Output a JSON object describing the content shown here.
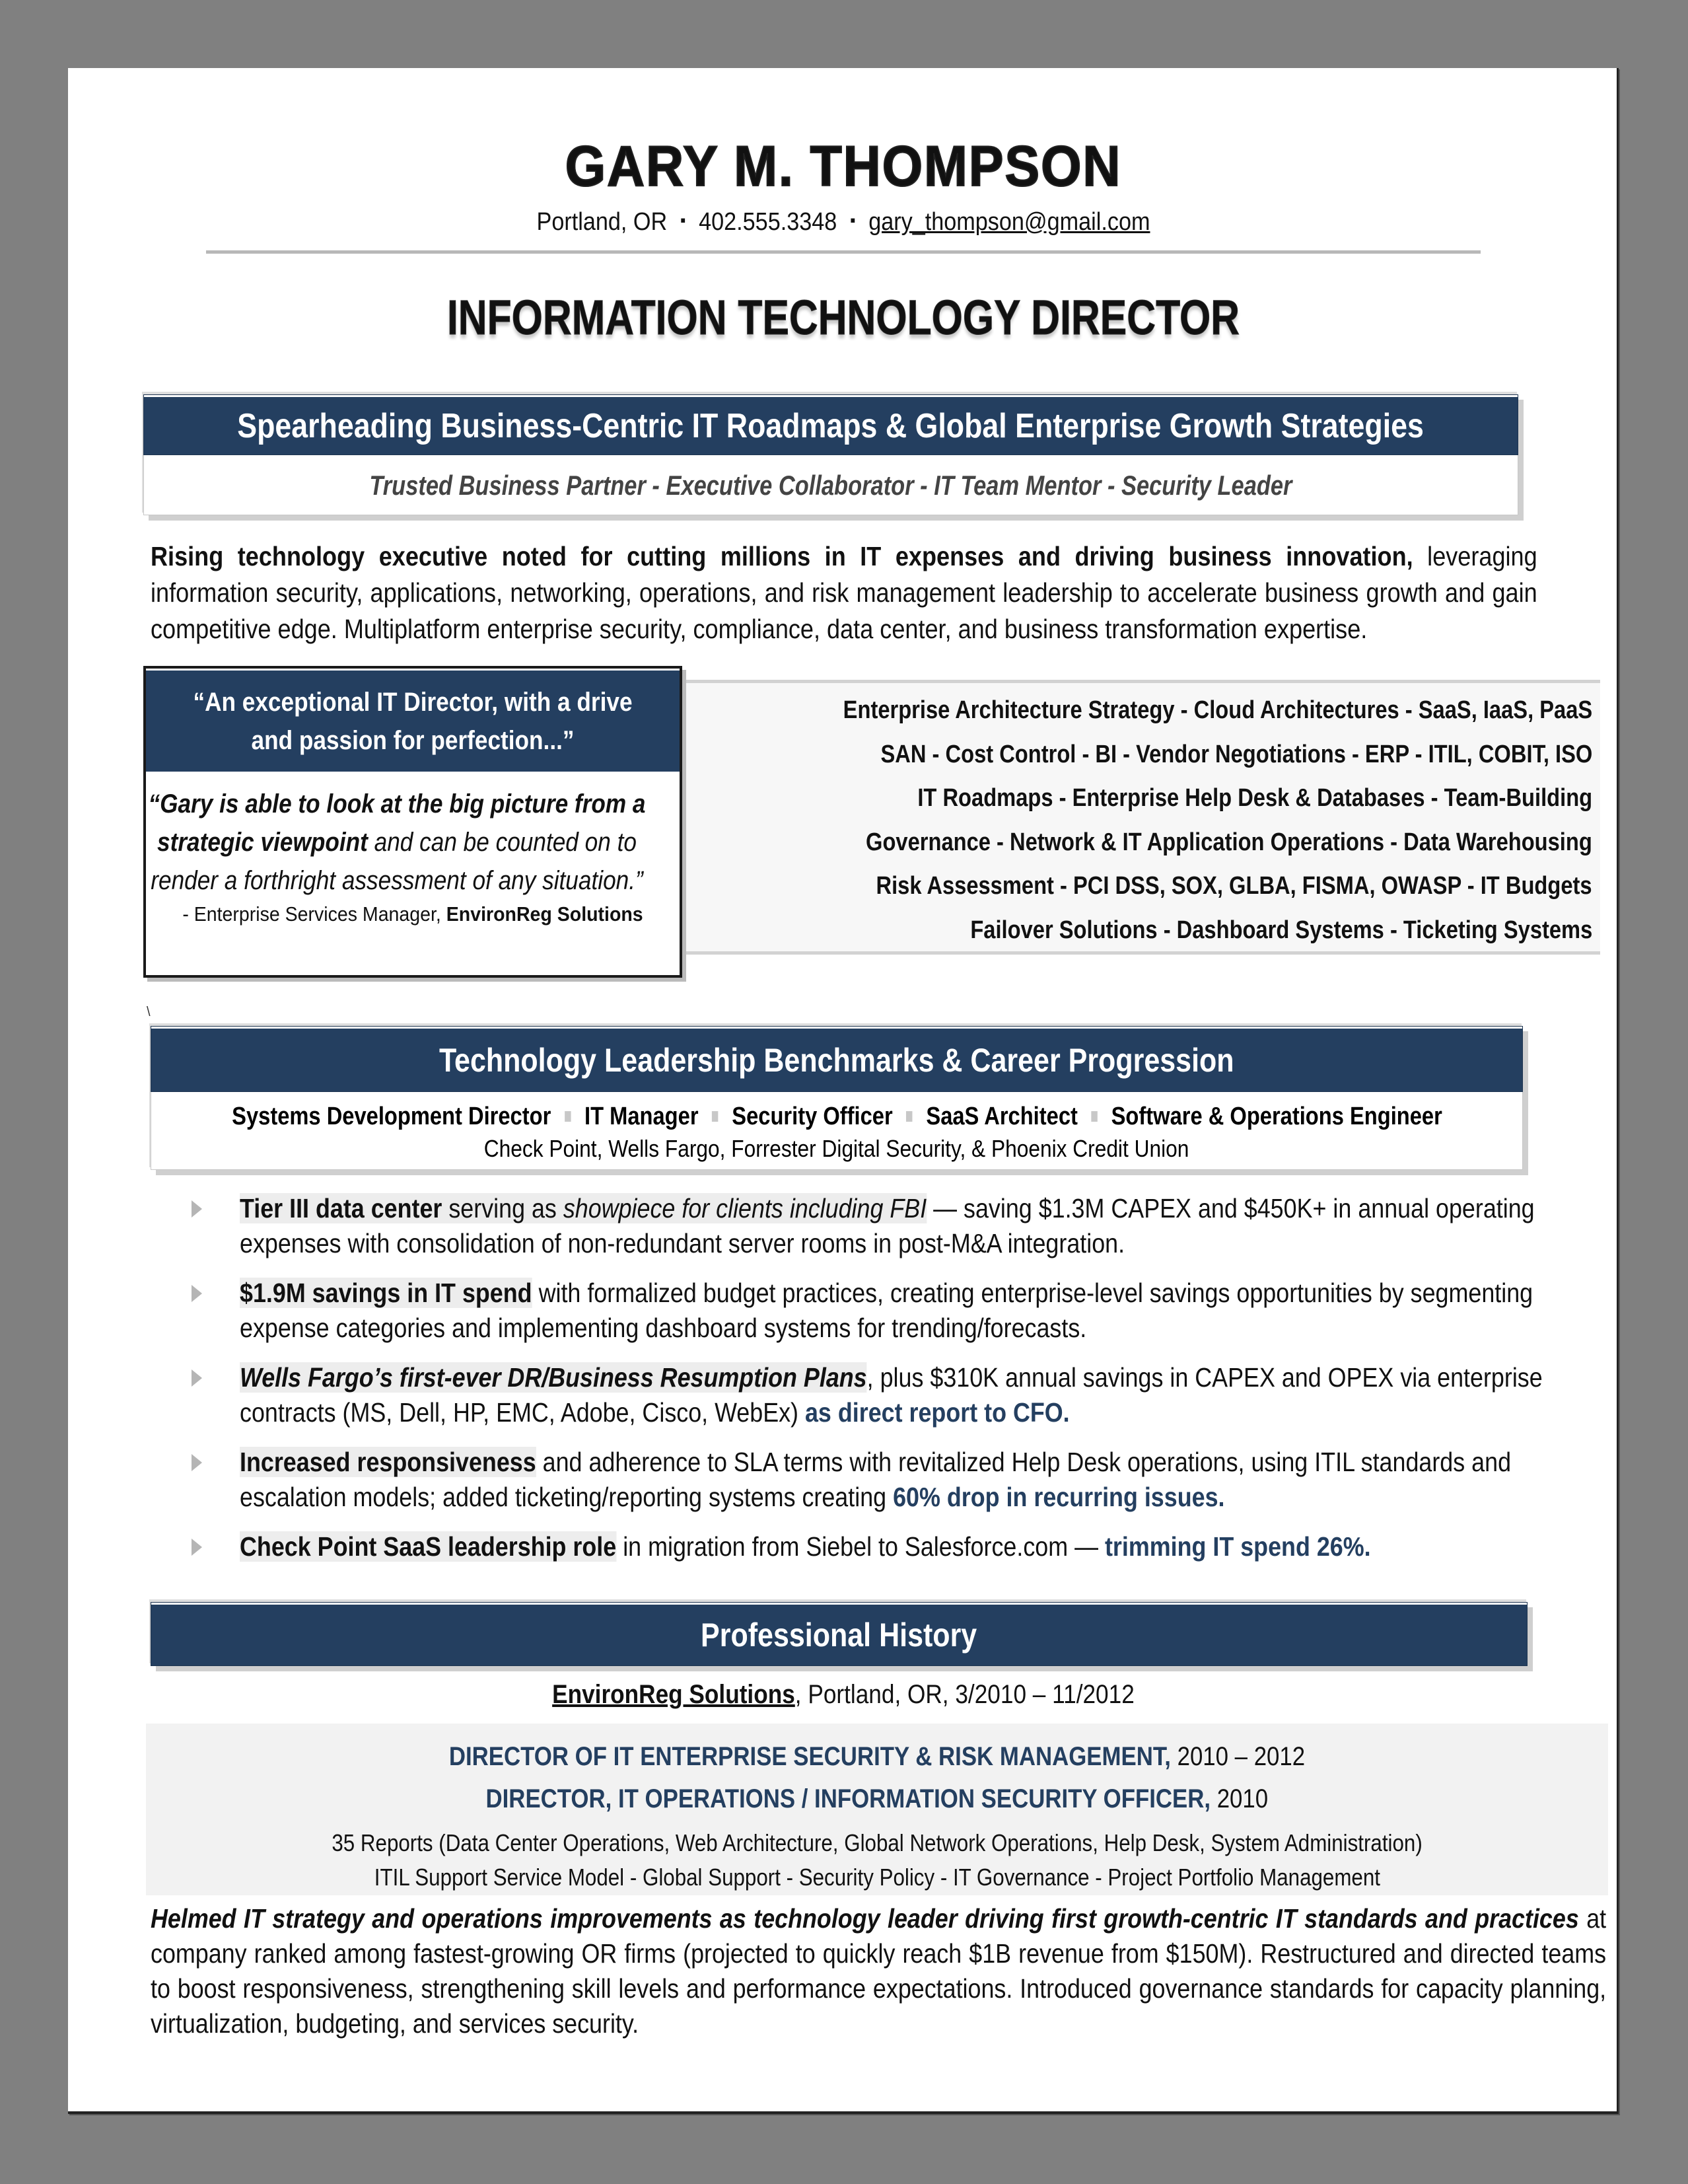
{
  "header": {
    "name": "GARY M. THOMPSON",
    "location": "Portland, OR",
    "phone": "402.555.3348",
    "email": "gary_thompson@gmail.com",
    "separator": "▪",
    "title": "INFORMATION TECHNOLOGY DIRECTOR"
  },
  "branding": {
    "headline": "Spearheading Business-Centric IT Roadmaps & Global Enterprise Growth Strategies",
    "tagline": "Trusted Business Partner  -  Executive Collaborator  -  IT Team Mentor  -  Security Leader"
  },
  "summary": {
    "lead_bold": "Rising technology executive noted for cutting millions in IT expenses and driving business innovation,",
    "rest": " leveraging information security, applications, networking, operations, and risk management leadership to accelerate business growth and gain competitive edge. Multiplatform enterprise security, compliance, data center, and business transformation expertise."
  },
  "testimonial": {
    "headline": "“An exceptional IT Director, with a drive and passion for perfection...”",
    "quote_bold": "“Gary is able to look at the big picture from a strategic viewpoint",
    "quote_rest": " and can be counted on to render a forthright assessment of any situation.”",
    "attribution_prefix": "- Enterprise Services Manager, ",
    "attribution_company": "EnvironReg Solutions"
  },
  "skills": {
    "lines": [
      "Enterprise Architecture Strategy  -  Cloud Architectures  - SaaS, IaaS, PaaS",
      "SAN  -  Cost Control  -  BI  -  Vendor Negotiations  -  ERP  -  ITIL, COBIT, ISO",
      "IT Roadmaps  -  Enterprise Help Desk & Databases -  Team-Building",
      "Governance  -  Network & IT Application Operations  -  Data Warehousing",
      "Risk Assessment  -  PCI DSS, SOX, GLBA, FISMA, OWASP  -  IT Budgets",
      "Failover Solutions  -  Dashboard Systems  -  Ticketing Systems"
    ]
  },
  "stray_mark": "\\",
  "career": {
    "heading": "Technology Leadership Benchmarks & Career Progression",
    "roles": [
      "Systems Development Director",
      "IT Manager",
      "Security Officer",
      "SaaS Architect",
      "Software & Operations Engineer"
    ],
    "companies": "Check Point, Wells Fargo, Forrester Digital Security, & Phoenix Credit Union"
  },
  "achievements": [
    {
      "lead": "Tier III data center",
      "mid_plain": " serving as ",
      "mid_italic": "showpiece for clients including FBI",
      "rest": " — saving $1.3M CAPEX and $450K+ in annual operating expenses with consolidation of non-redundant server rooms in post-M&A integration.",
      "accent": ""
    },
    {
      "lead": "$1.9M savings in IT spend",
      "rest": " with formalized budget practices, creating enterprise-level savings opportunities by segmenting expense categories and implementing dashboard systems for trending/forecasts.",
      "accent": ""
    },
    {
      "lead": "Wells Fargo’s first-ever DR/Business Resumption Plans",
      "rest": ", plus $310K annual savings in CAPEX and OPEX via enterprise contracts (MS, Dell, HP, EMC, Adobe, Cisco, WebEx) ",
      "accent": "as direct report to CFO."
    },
    {
      "lead": "Increased responsiveness",
      "rest": " and adherence to SLA terms with revitalized Help Desk operations, using ITIL standards and escalation models; added ticketing/reporting systems creating ",
      "accent": "60% drop in recurring issues."
    },
    {
      "lead": "Check Point SaaS leadership role",
      "rest": " in migration from Siebel to Salesforce.com — ",
      "accent": "trimming IT spend 26%."
    }
  ],
  "history": {
    "heading": "Professional History",
    "company": "EnvironReg Solutions",
    "company_details": ", Portland, OR, 3/2010 – 11/2012",
    "roles": [
      {
        "title": "DIRECTOR OF IT ENTERPRISE SECURITY & RISK MANAGEMENT,",
        "years": " 2010 – 2012"
      },
      {
        "title": "DIRECTOR, IT OPERATIONS / INFORMATION SECURITY OFFICER,",
        "years": " 2010"
      }
    ],
    "scope": "35 Reports (Data Center Operations, Web Architecture, Global Network Operations, Help Desk, System Administration)",
    "focus": "ITIL Support Service Model  -  Global Support  -  Security Policy  -  IT Governance  -  Project Portfolio Management",
    "para_lead": "Helmed IT strategy and operations improvements as technology leader driving first growth-centric IT standards and practices",
    "para_rest": " at company ranked among fastest-growing OR firms (projected to quickly reach $1B revenue from $150M). Restructured and directed teams to boost responsiveness, strengthening skill levels and performance expectations. Introduced governance standards for capacity planning, virtualization, budgeting, and services security."
  },
  "colors": {
    "navy": "#243F60",
    "background": "#808080",
    "highlight": "#EDEDED"
  }
}
